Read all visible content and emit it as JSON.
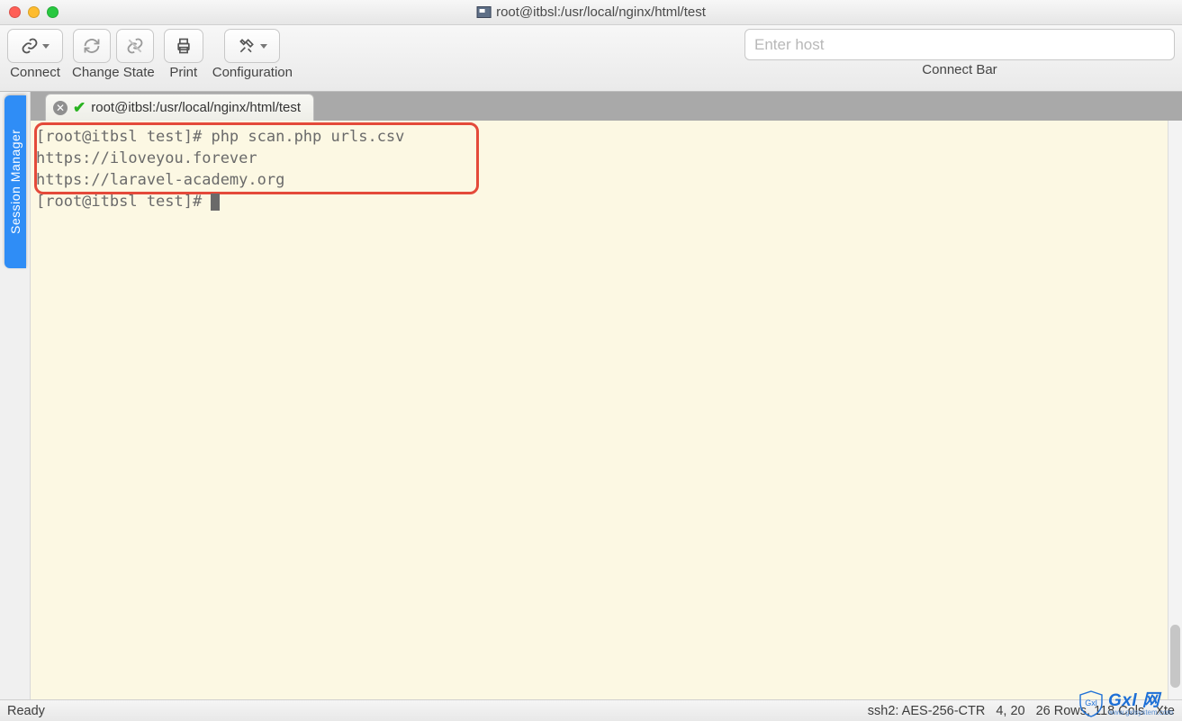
{
  "window": {
    "title": "root@itbsl:/usr/local/nginx/html/test"
  },
  "toolbar": {
    "connect_label": "Connect",
    "change_state_label": "Change State",
    "print_label": "Print",
    "configuration_label": "Configuration",
    "connect_bar_label": "Connect Bar",
    "host_placeholder": "Enter host"
  },
  "sidebar": {
    "session_manager_label": "Session Manager"
  },
  "tabs": [
    {
      "label": "root@itbsl:/usr/local/nginx/html/test",
      "status": "connected"
    }
  ],
  "terminal": {
    "lines": [
      "[root@itbsl test]# php scan.php urls.csv",
      "https://iloveyou.forever",
      "https://laravel-academy.org",
      "[root@itbsl test]# "
    ]
  },
  "statusbar": {
    "left": "Ready",
    "encryption": "ssh2: AES-256-CTR",
    "cursor": "4, 20",
    "dimensions": "26 Rows, 118 Cols",
    "term": "Xte"
  },
  "watermark": {
    "big": "Gxl 网",
    "small": "www.gxlsystem.com",
    "shield_text": "Gxl"
  }
}
